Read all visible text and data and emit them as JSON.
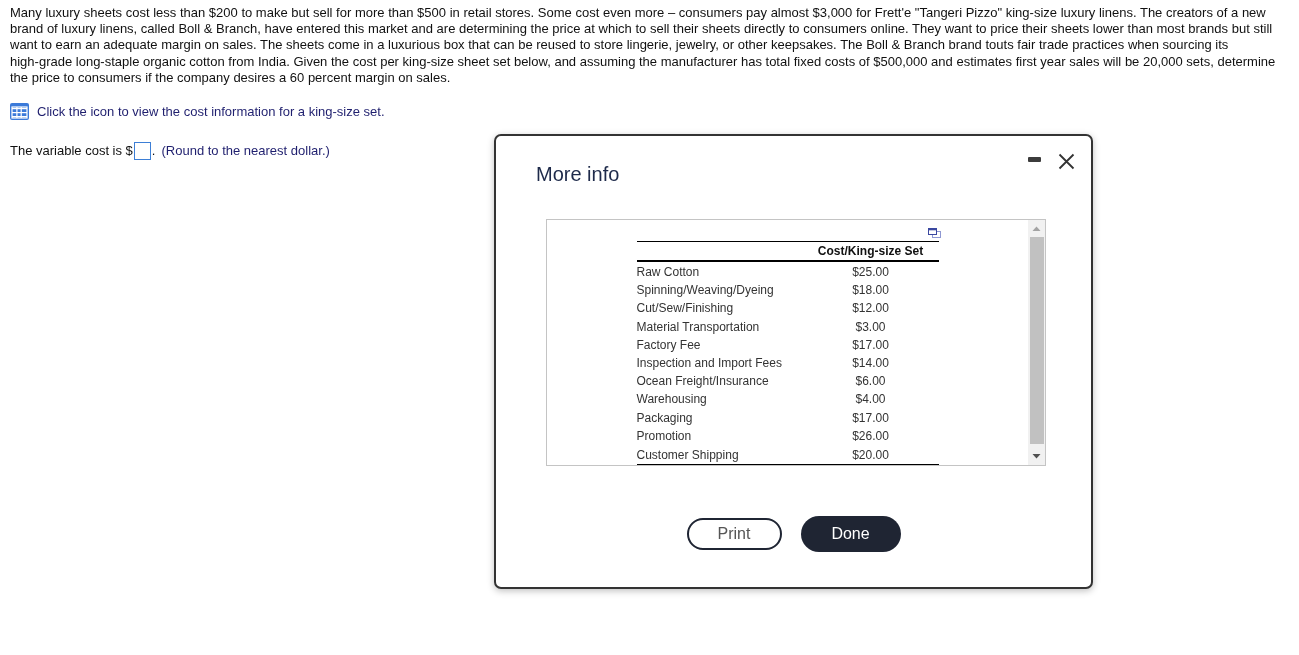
{
  "problem": {
    "text": "Many luxury sheets cost less than $200 to make but sell for more than $500 in retail stores. Some cost even more – consumers pay almost $3,000 for Frett'e \"Tangeri Pizzo\" king-size luxury linens. The creators of a new brand of luxury linens, called Boll & Branch, have entered this market and are determining the price at which to sell their sheets directly to consumers online. They want to price their sheets lower than most brands but still want to earn an adequate margin on sales. The sheets come in a luxurious box that can be reused to store lingerie, jewelry, or other keepsakes. The Boll & Branch brand touts fair trade practices when sourcing its high-grade long-staple organic cotton from India. Given the cost per king-size sheet set below, and assuming the manufacturer has total fixed costs of $500,000 and estimates first year sales will be 20,000 sets, determine the price to consumers if the company desires a 60 percent margin on sales."
  },
  "info_prompt": {
    "text": "Click the icon to view the cost information for a king-size set."
  },
  "question": {
    "prefix": "The variable cost is $",
    "suffix": ".",
    "hint": "(Round to the nearest dollar.)"
  },
  "dialog": {
    "title": "More info",
    "table": {
      "value_header": "Cost/King-size Set",
      "rows": [
        {
          "label": "Raw Cotton",
          "value": "$25.00"
        },
        {
          "label": "Spinning/Weaving/Dyeing",
          "value": "$18.00"
        },
        {
          "label": "Cut/Sew/Finishing",
          "value": "$12.00"
        },
        {
          "label": "Material Transportation",
          "value": "$3.00"
        },
        {
          "label": "Factory Fee",
          "value": "$17.00"
        },
        {
          "label": "Inspection and Import Fees",
          "value": "$14.00"
        },
        {
          "label": "Ocean Freight/Insurance",
          "value": "$6.00"
        },
        {
          "label": "Warehousing",
          "value": "$4.00"
        },
        {
          "label": "Packaging",
          "value": "$17.00"
        },
        {
          "label": "Promotion",
          "value": "$26.00"
        },
        {
          "label": "Customer Shipping",
          "value": "$20.00"
        }
      ]
    },
    "buttons": [
      {
        "label": "Print",
        "kind": "outline"
      },
      {
        "label": "Done",
        "kind": "primary"
      }
    ]
  }
}
